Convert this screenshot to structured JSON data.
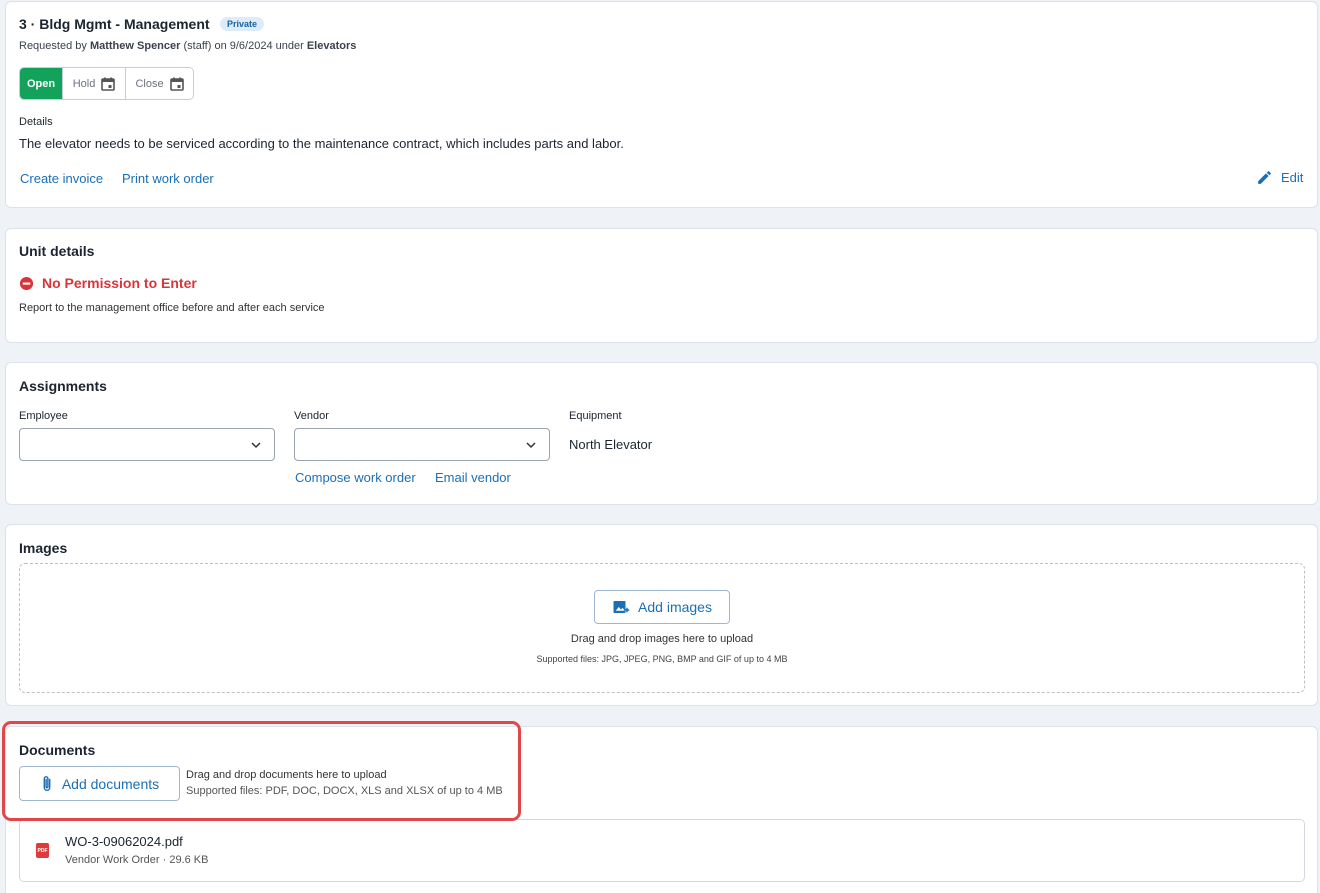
{
  "header": {
    "title": "3 · Bldg Mgmt - Management",
    "badge": "Private",
    "requested_prefix": "Requested by",
    "requester": "Matthew Spencer",
    "requester_role": "(staff) on 9/6/2024 under",
    "category": "Elevators"
  },
  "status": {
    "open": "Open",
    "hold": "Hold",
    "close": "Close"
  },
  "details": {
    "label": "Details",
    "text": "The elevator needs to be serviced according to the maintenance contract, which includes parts and labor."
  },
  "actions": {
    "create_invoice": "Create invoice",
    "print_work_order": "Print work order",
    "edit": "Edit"
  },
  "unit_details": {
    "title": "Unit details",
    "permission": "No Permission to Enter",
    "note": "Report to the management office before and after each service"
  },
  "assignments": {
    "title": "Assignments",
    "employee_label": "Employee",
    "employee_value": "",
    "vendor_label": "Vendor",
    "vendor_value": "",
    "equipment_label": "Equipment",
    "equipment_value": "North Elevator",
    "compose_work_order": "Compose work order",
    "email_vendor": "Email vendor"
  },
  "images": {
    "title": "Images",
    "add_button": "Add images",
    "drag_text": "Drag and drop images here to upload",
    "supported": "Supported files: JPG, JPEG, PNG, BMP and GIF of up to 4 MB"
  },
  "documents": {
    "title": "Documents",
    "add_button": "Add documents",
    "drag_text": "Drag and drop documents here to upload",
    "supported": "Supported files: PDF, DOC, DOCX, XLS and XLSX of up to 4 MB",
    "files": [
      {
        "name": "WO-3-09062024.pdf",
        "meta": "Vendor Work Order · 29.6 KB",
        "icon": "pdf-icon",
        "icon_text": "PDF"
      }
    ]
  },
  "colors": {
    "accent": "#1b6fb6",
    "open_green": "#13a25a",
    "danger_red": "#d6363b",
    "highlight_red": "#e0474b"
  }
}
